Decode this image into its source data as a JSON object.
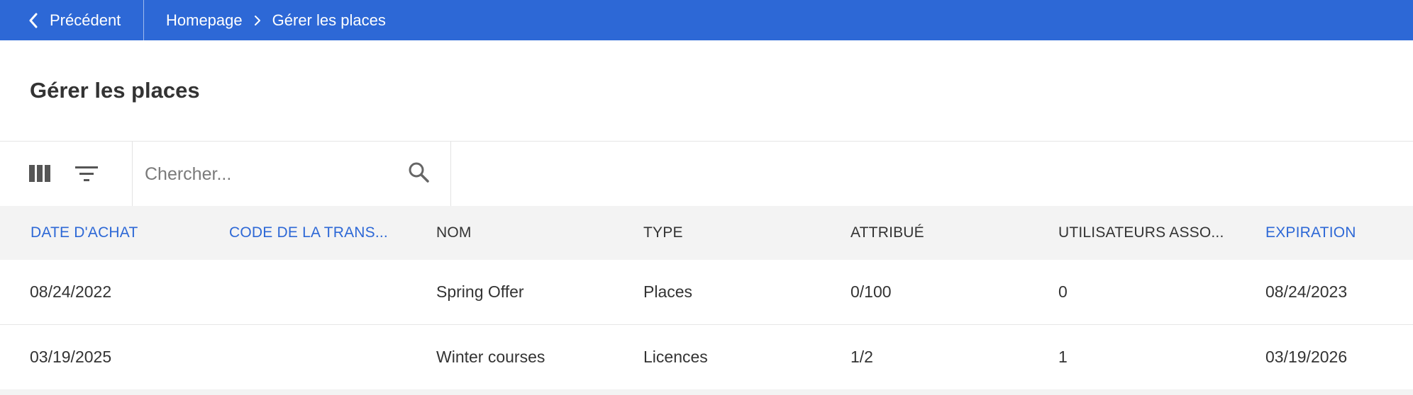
{
  "topbar": {
    "back_label": "Précédent",
    "breadcrumb": [
      "Homepage",
      "Gérer les places"
    ],
    "icons": {
      "back": "chevron-left-icon",
      "separator": "chevron-right-icon"
    },
    "background_color": "#2d68d6"
  },
  "page": {
    "title": "Gérer les places"
  },
  "toolbar": {
    "columns_icon": "columns-icon",
    "filter_icon": "filter-icon",
    "search": {
      "placeholder": "Chercher...",
      "value": "",
      "icon": "search-icon"
    }
  },
  "table": {
    "columns": [
      {
        "label": "DATE D'ACHAT",
        "sortable": true
      },
      {
        "label": "CODE DE LA TRANS...",
        "sortable": true
      },
      {
        "label": "NOM",
        "sortable": false
      },
      {
        "label": "TYPE",
        "sortable": false
      },
      {
        "label": "ATTRIBUÉ",
        "sortable": false
      },
      {
        "label": "UTILISATEURS ASSO...",
        "sortable": false
      },
      {
        "label": "EXPIRATION",
        "sortable": true
      }
    ],
    "rows": [
      [
        "08/24/2022",
        "",
        "Spring Offer",
        "Places",
        "0/100",
        "0",
        "08/24/2023"
      ],
      [
        "03/19/2025",
        "",
        "Winter courses",
        "Licences",
        "1/2",
        "1",
        "03/19/2026"
      ]
    ]
  },
  "colors": {
    "accent": "#2d68d6",
    "header_bg": "#f3f3f3",
    "text": "#333333"
  }
}
